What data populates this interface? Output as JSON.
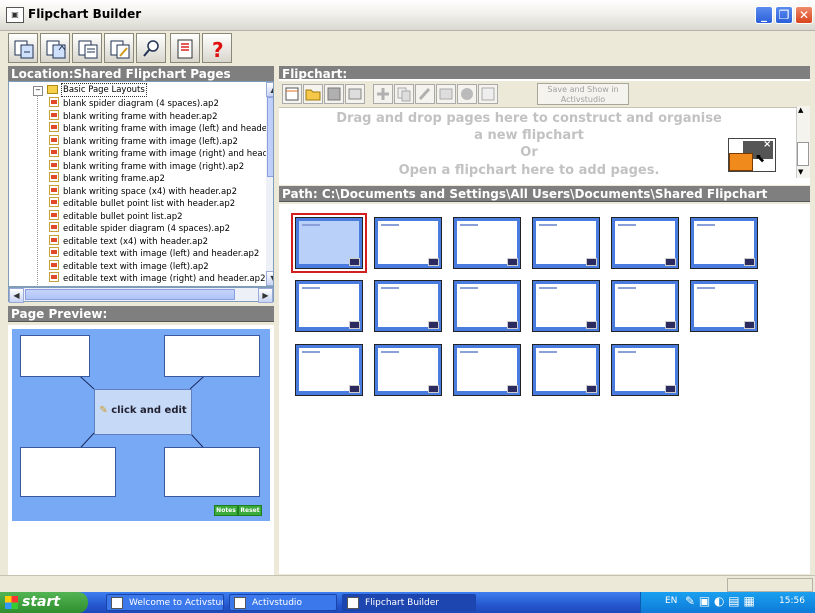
{
  "window": {
    "title": "Flipchart Builder",
    "minimize": "_",
    "maximize": "❐",
    "close": "✕"
  },
  "location": {
    "header": "Location:Shared Flipchart Pages",
    "folder": "Basic Page Layouts",
    "items": [
      "blank spider diagram (4 spaces).ap2",
      "blank writing frame with header.ap2",
      "blank writing frame with image (left) and heade",
      "blank writing frame with image (left).ap2",
      "blank writing frame with image (right) and head",
      "blank writing frame with image (right).ap2",
      "blank writing frame.ap2",
      "blank writing space (x4) with header.ap2",
      "editable bullet point list with header.ap2",
      "editable bullet point list.ap2",
      "editable spider diagram (4 spaces).ap2",
      "editable text (x4) with header.ap2",
      "editable text with image (left) and header.ap2",
      "editable text with image (left).ap2",
      "editable text with image (right) and header.ap2"
    ]
  },
  "preview": {
    "header": "Page Preview:",
    "center_text": "click and edit",
    "notes_button": "Notes",
    "reset_button": "Reset"
  },
  "flipchart": {
    "header": "Flipchart:",
    "save_show_label": "Save and Show in Activstudio",
    "drop_line1": "Drag and drop pages here to construct and organise",
    "drop_line2": "a new flipchart",
    "drop_line3": "Or",
    "drop_line4": "Open a flipchart here to add pages."
  },
  "path": {
    "label": "Path: C:\\Documents and Settings\\All Users\\Documents\\Shared Flipchart"
  },
  "taskbar": {
    "start": "start",
    "tasks": [
      "Welcome to Activstud...",
      "Activstudio",
      "Flipchart Builder"
    ],
    "tray_lang": "EN",
    "clock": "15:56"
  },
  "colors": {
    "accent": "#4a7ce0",
    "panel_header": "#7f7f7f",
    "selection": "#d21f1f",
    "help_red": "#e01010"
  }
}
